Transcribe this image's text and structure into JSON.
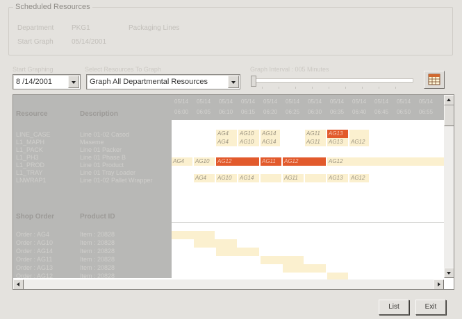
{
  "group": {
    "title": "Scheduled Resources"
  },
  "info": {
    "department_label": "Department",
    "department_code": "PKG1",
    "department_name": "Packaging Lines",
    "start_graph_label": "Start Graph",
    "start_graph_value": "05/14/2001"
  },
  "controls": {
    "start_graphing_label": "Start Graphing",
    "start_graphing_value": "8 /14/2001",
    "select_resources_label": "Select Resources To Graph",
    "select_resources_value": "Graph All Departmental Resources",
    "interval_label": "Graph Interval : 005 Minutes"
  },
  "table": {
    "resource_header": "Resource",
    "description_header": "Description",
    "shop_order_header": "Shop Order",
    "product_header": "Product ID",
    "resources": [
      {
        "id": "LINE_CASE",
        "desc": "Line 01-02 Casod"
      },
      {
        "id": "L1_MAPH",
        "desc": "Maseme"
      },
      {
        "id": "L1_PACK",
        "desc": "Line 01 Packer"
      },
      {
        "id": "L1_PH3",
        "desc": "Line 01 Phase B"
      },
      {
        "id": "L1_PROD",
        "desc": "Line 01 Product"
      },
      {
        "id": "L1_TRAY",
        "desc": "Line 01 Tray Loader"
      },
      {
        "id": "LNWRAP1",
        "desc": "Line 01-02 Pallet Wrapper"
      }
    ],
    "orders": [
      {
        "id": "Order : AG4",
        "product": "Item : 20828"
      },
      {
        "id": "Order : AG10",
        "product": "Item : 20828"
      },
      {
        "id": "Order : AG14",
        "product": "Item : 20828"
      },
      {
        "id": "Order : AG11",
        "product": "Item : 20828"
      },
      {
        "id": "Order : AG13",
        "product": "Item : 20828"
      },
      {
        "id": "Order : AG12",
        "product": "Item : 20828"
      }
    ]
  },
  "timeline": {
    "dates": [
      "05/14",
      "05/14",
      "05/14",
      "05/14",
      "05/14",
      "05/14",
      "05/14",
      "05/14",
      "05/14",
      "05/14",
      "05/14",
      "05/14"
    ],
    "times": [
      "06:00",
      "06:05",
      "06:10",
      "06:15",
      "06:20",
      "06:25",
      "06:30",
      "06:35",
      "06:40",
      "06:45",
      "06:50",
      "06:55"
    ]
  },
  "bar_labels": {
    "ag4": "AG4",
    "ag10": "AG10",
    "ag14": "AG14",
    "ag11": "AG11",
    "ag13": "AG13",
    "ag12": "AG12"
  },
  "buttons": {
    "list": "List",
    "exit": "Exit"
  },
  "colors": {
    "bar": "#fbf0cf",
    "bar_active": "#e25a2c",
    "grid_header": "#b8b8b6"
  },
  "icons": {
    "calendar": "calendar-grid-icon"
  }
}
